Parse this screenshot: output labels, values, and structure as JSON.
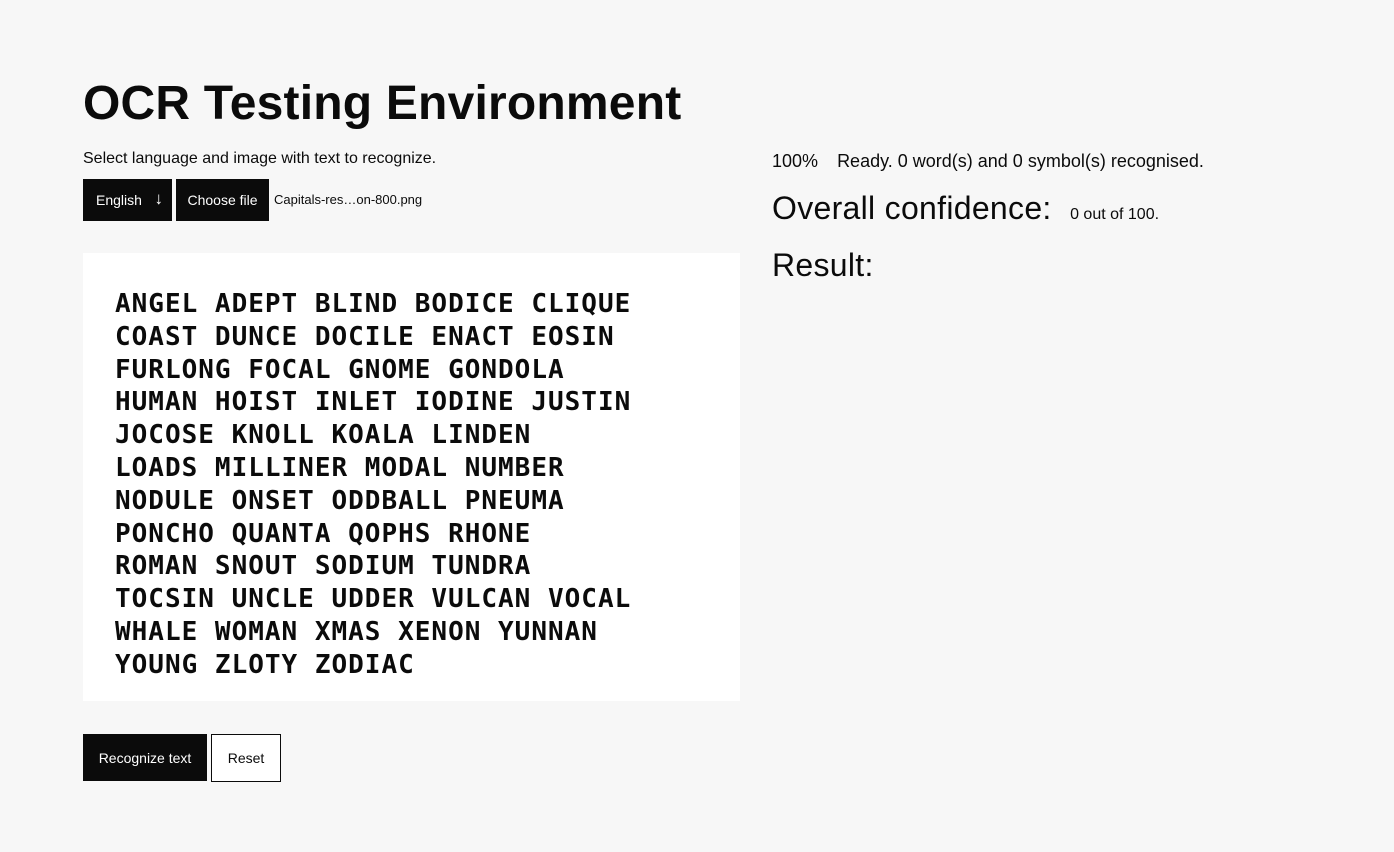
{
  "header": {
    "title": "OCR Testing Environment",
    "subtitle": "Select language and image with text to recognize."
  },
  "controls": {
    "language_selected": "English",
    "language_arrow": "↓",
    "choose_file_label": "Choose file",
    "file_name": "Capitals-res…on-800.png"
  },
  "preview": {
    "lines": [
      "Angel Adept Blind Bodice Clique",
      "Coast Dunce Docile Enact Eosin",
      "Furlong Focal Gnome Gondola",
      "Human Hoist Inlet Iodine Justin",
      "Jocose Knoll Koala Linden",
      "Loads Milliner Modal Number",
      "Nodule Onset Oddball Pneuma",
      "Poncho Quanta Qophs Rhone",
      "Roman Snout Sodium Tundra",
      "Tocsin Uncle Udder Vulcan Vocal",
      "Whale Woman Xmas Xenon Yunnan",
      "Young Zloty Zodiac"
    ]
  },
  "actions": {
    "recognize_label": "Recognize text",
    "reset_label": "Reset"
  },
  "status": {
    "progress": "100%",
    "message": "Ready. 0 word(s) and 0 symbol(s) recognised."
  },
  "confidence": {
    "label": "Overall confidence:",
    "value": "0 out of 100."
  },
  "result": {
    "label": "Result:",
    "text": ""
  }
}
